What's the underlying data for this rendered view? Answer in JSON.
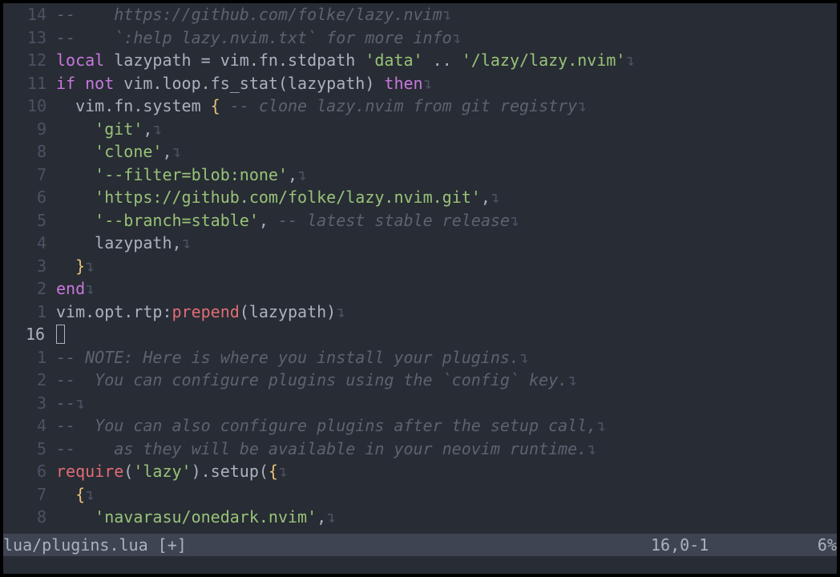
{
  "newline_glyph": "↴",
  "lines": [
    {
      "num": "14",
      "tokens": [
        {
          "t": "cmt",
          "v": "--    https://github.com/folke/lazy.nvim"
        }
      ]
    },
    {
      "num": "13",
      "tokens": [
        {
          "t": "cmt",
          "v": "--    `:help lazy.nvim.txt` for more info"
        }
      ]
    },
    {
      "num": "12",
      "tokens": [
        {
          "t": "kw",
          "v": "local"
        },
        {
          "t": "code",
          "v": " lazypath = vim.fn.stdpath "
        },
        {
          "t": "str",
          "v": "'data'"
        },
        {
          "t": "code",
          "v": " .. "
        },
        {
          "t": "str",
          "v": "'/lazy/lazy.nvim'"
        }
      ]
    },
    {
      "num": "11",
      "tokens": [
        {
          "t": "kw",
          "v": "if"
        },
        {
          "t": "code",
          "v": " "
        },
        {
          "t": "kw",
          "v": "not"
        },
        {
          "t": "code",
          "v": " vim.loop.fs_stat(lazypath) "
        },
        {
          "t": "kw",
          "v": "then"
        }
      ]
    },
    {
      "num": "10",
      "tokens": [
        {
          "t": "code",
          "v": "  vim.fn.system "
        },
        {
          "t": "brace",
          "v": "{"
        },
        {
          "t": "code",
          "v": " "
        },
        {
          "t": "cmt",
          "v": "-- clone lazy.nvim from git registry"
        }
      ]
    },
    {
      "num": "9",
      "tokens": [
        {
          "t": "code",
          "v": "    "
        },
        {
          "t": "str",
          "v": "'git'"
        },
        {
          "t": "code",
          "v": ","
        }
      ]
    },
    {
      "num": "8",
      "tokens": [
        {
          "t": "code",
          "v": "    "
        },
        {
          "t": "str",
          "v": "'clone'"
        },
        {
          "t": "code",
          "v": ","
        }
      ]
    },
    {
      "num": "7",
      "tokens": [
        {
          "t": "code",
          "v": "    "
        },
        {
          "t": "str",
          "v": "'--filter=blob:none'"
        },
        {
          "t": "code",
          "v": ","
        }
      ]
    },
    {
      "num": "6",
      "tokens": [
        {
          "t": "code",
          "v": "    "
        },
        {
          "t": "str",
          "v": "'https://github.com/folke/lazy.nvim.git'"
        },
        {
          "t": "code",
          "v": ","
        }
      ]
    },
    {
      "num": "5",
      "tokens": [
        {
          "t": "code",
          "v": "    "
        },
        {
          "t": "str",
          "v": "'--branch=stable'"
        },
        {
          "t": "code",
          "v": ", "
        },
        {
          "t": "cmt",
          "v": "-- latest stable release"
        }
      ]
    },
    {
      "num": "4",
      "tokens": [
        {
          "t": "code",
          "v": "    lazypath,"
        }
      ]
    },
    {
      "num": "3",
      "tokens": [
        {
          "t": "code",
          "v": "  "
        },
        {
          "t": "brace",
          "v": "}"
        }
      ]
    },
    {
      "num": "2",
      "tokens": [
        {
          "t": "kw",
          "v": "end"
        }
      ]
    },
    {
      "num": "1",
      "tokens": [
        {
          "t": "code",
          "v": "vim.opt.rtp:"
        },
        {
          "t": "fn",
          "v": "prepend"
        },
        {
          "t": "code",
          "v": "(lazypath)"
        }
      ]
    },
    {
      "num": "16",
      "current": true,
      "tokens": []
    },
    {
      "num": "1",
      "tokens": [
        {
          "t": "cmt",
          "v": "-- NOTE: Here is where you install your plugins."
        }
      ]
    },
    {
      "num": "2",
      "tokens": [
        {
          "t": "cmt",
          "v": "--  You can configure plugins using the `config` key."
        }
      ]
    },
    {
      "num": "3",
      "tokens": [
        {
          "t": "cmt",
          "v": "--"
        }
      ]
    },
    {
      "num": "4",
      "tokens": [
        {
          "t": "cmt",
          "v": "--  You can also configure plugins after the setup call,"
        }
      ]
    },
    {
      "num": "5",
      "tokens": [
        {
          "t": "cmt",
          "v": "--    as they will be available in your neovim runtime."
        }
      ]
    },
    {
      "num": "6",
      "tokens": [
        {
          "t": "fn",
          "v": "require"
        },
        {
          "t": "code",
          "v": "("
        },
        {
          "t": "str",
          "v": "'lazy'"
        },
        {
          "t": "code",
          "v": ").setup("
        },
        {
          "t": "brace",
          "v": "{"
        }
      ]
    },
    {
      "num": "7",
      "tokens": [
        {
          "t": "code",
          "v": "  "
        },
        {
          "t": "brace",
          "v": "{"
        }
      ]
    },
    {
      "num": "8",
      "tokens": [
        {
          "t": "code",
          "v": "    "
        },
        {
          "t": "str",
          "v": "'navarasu/onedark.nvim'"
        },
        {
          "t": "code",
          "v": ","
        }
      ]
    }
  ],
  "statusline": {
    "file": "lua/plugins.lua [+]",
    "position": "16,0-1",
    "percent": "6%"
  }
}
